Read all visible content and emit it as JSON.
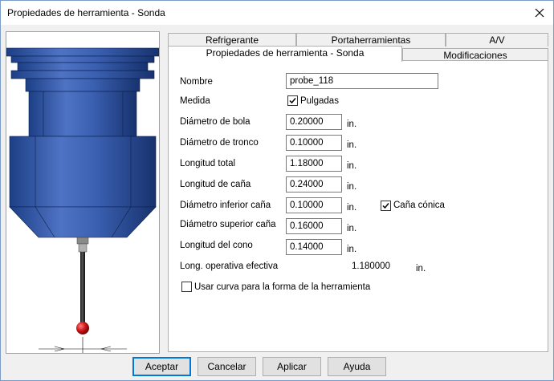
{
  "window": {
    "title": "Propiedades de herramienta - Sonda"
  },
  "tabs": {
    "row_back": [
      "Refrigerante",
      "Portaherramientas",
      "A/V"
    ],
    "row_front": [
      "Propiedades de herramienta - Sonda",
      "Modificaciones"
    ],
    "active": "Propiedades de herramienta - Sonda"
  },
  "form": {
    "name": {
      "label": "Nombre",
      "value": "probe_118"
    },
    "units": {
      "label": "Medida",
      "checkbox_label": "Pulgadas",
      "checked": true
    },
    "fields": [
      {
        "label": "Diámetro de bola",
        "value": "0.20000",
        "unit": "in."
      },
      {
        "label": "Diámetro de tronco",
        "value": "0.10000",
        "unit": "in."
      },
      {
        "label": "Longitud total",
        "value": "1.18000",
        "unit": "in."
      },
      {
        "label": "Longitud de caña",
        "value": "0.24000",
        "unit": "in."
      },
      {
        "label": "Diámetro inferior caña",
        "value": "0.10000",
        "unit": "in."
      },
      {
        "label": "Diámetro superior caña",
        "value": "0.16000",
        "unit": "in."
      },
      {
        "label": "Longitud del cono",
        "value": "0.14000",
        "unit": "in."
      }
    ],
    "tapered": {
      "label": "Caña cónica",
      "checked": true
    },
    "effective": {
      "label": "Long. operativa efectiva",
      "value": "1.180000",
      "unit": "in."
    },
    "curve": {
      "label": "Usar curva para la forma de la herramienta",
      "checked": false
    }
  },
  "buttons": {
    "ok": "Aceptar",
    "cancel": "Cancelar",
    "apply": "Aplicar",
    "help": "Ayuda"
  }
}
